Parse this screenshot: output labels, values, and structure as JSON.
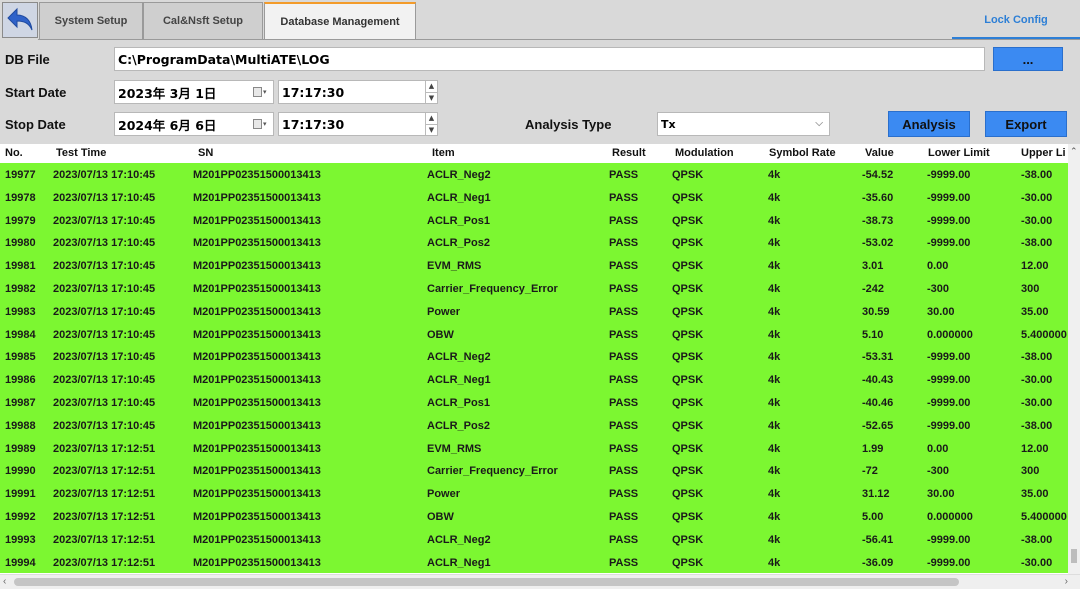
{
  "tabs": [
    {
      "label": "System Setup"
    },
    {
      "label": "Cal&Nsft Setup"
    },
    {
      "label": "Database Management"
    }
  ],
  "lock_config": "Lock Config",
  "form": {
    "db_file_label": "DB File",
    "db_file_value": "C:\\ProgramData\\MultiATE\\LOG",
    "browse_label": "...",
    "start_date_label": "Start Date",
    "start_date_value": "2023年  3月  1日",
    "start_time_value": "17:17:30",
    "stop_date_label": "Stop Date",
    "stop_date_value": "2024年  6月  6日",
    "stop_time_value": "17:17:30",
    "analysis_type_label": "Analysis Type",
    "analysis_type_value": "Tx",
    "analysis_button": "Analysis",
    "export_button": "Export"
  },
  "table": {
    "headers": [
      "No.",
      "Test Time",
      "SN",
      "Item",
      "Result",
      "Modulation",
      "Symbol Rate",
      "Value",
      "Lower Limit",
      "Upper Li"
    ],
    "rows": [
      [
        "19977",
        "2023/07/13 17:10:45",
        "M201PP02351500013413",
        "ACLR_Neg2",
        "PASS",
        "QPSK",
        "4k",
        "-54.52",
        "-9999.00",
        "-38.00"
      ],
      [
        "19978",
        "2023/07/13 17:10:45",
        "M201PP02351500013413",
        "ACLR_Neg1",
        "PASS",
        "QPSK",
        "4k",
        "-35.60",
        "-9999.00",
        "-30.00"
      ],
      [
        "19979",
        "2023/07/13 17:10:45",
        "M201PP02351500013413",
        "ACLR_Pos1",
        "PASS",
        "QPSK",
        "4k",
        "-38.73",
        "-9999.00",
        "-30.00"
      ],
      [
        "19980",
        "2023/07/13 17:10:45",
        "M201PP02351500013413",
        "ACLR_Pos2",
        "PASS",
        "QPSK",
        "4k",
        "-53.02",
        "-9999.00",
        "-38.00"
      ],
      [
        "19981",
        "2023/07/13 17:10:45",
        "M201PP02351500013413",
        "EVM_RMS",
        "PASS",
        "QPSK",
        "4k",
        "3.01",
        "0.00",
        "12.00"
      ],
      [
        "19982",
        "2023/07/13 17:10:45",
        "M201PP02351500013413",
        "Carrier_Frequency_Error",
        "PASS",
        "QPSK",
        "4k",
        "-242",
        "-300",
        "300"
      ],
      [
        "19983",
        "2023/07/13 17:10:45",
        "M201PP02351500013413",
        "Power",
        "PASS",
        "QPSK",
        "4k",
        "30.59",
        "30.00",
        "35.00"
      ],
      [
        "19984",
        "2023/07/13 17:10:45",
        "M201PP02351500013413",
        "OBW",
        "PASS",
        "QPSK",
        "4k",
        "5.10",
        "0.000000",
        "5.400000"
      ],
      [
        "19985",
        "2023/07/13 17:10:45",
        "M201PP02351500013413",
        "ACLR_Neg2",
        "PASS",
        "QPSK",
        "4k",
        "-53.31",
        "-9999.00",
        "-38.00"
      ],
      [
        "19986",
        "2023/07/13 17:10:45",
        "M201PP02351500013413",
        "ACLR_Neg1",
        "PASS",
        "QPSK",
        "4k",
        "-40.43",
        "-9999.00",
        "-30.00"
      ],
      [
        "19987",
        "2023/07/13 17:10:45",
        "M201PP02351500013413",
        "ACLR_Pos1",
        "PASS",
        "QPSK",
        "4k",
        "-40.46",
        "-9999.00",
        "-30.00"
      ],
      [
        "19988",
        "2023/07/13 17:10:45",
        "M201PP02351500013413",
        "ACLR_Pos2",
        "PASS",
        "QPSK",
        "4k",
        "-52.65",
        "-9999.00",
        "-38.00"
      ],
      [
        "19989",
        "2023/07/13 17:12:51",
        "M201PP02351500013413",
        "EVM_RMS",
        "PASS",
        "QPSK",
        "4k",
        "1.99",
        "0.00",
        "12.00"
      ],
      [
        "19990",
        "2023/07/13 17:12:51",
        "M201PP02351500013413",
        "Carrier_Frequency_Error",
        "PASS",
        "QPSK",
        "4k",
        "-72",
        "-300",
        "300"
      ],
      [
        "19991",
        "2023/07/13 17:12:51",
        "M201PP02351500013413",
        "Power",
        "PASS",
        "QPSK",
        "4k",
        "31.12",
        "30.00",
        "35.00"
      ],
      [
        "19992",
        "2023/07/13 17:12:51",
        "M201PP02351500013413",
        "OBW",
        "PASS",
        "QPSK",
        "4k",
        "5.00",
        "0.000000",
        "5.400000"
      ],
      [
        "19993",
        "2023/07/13 17:12:51",
        "M201PP02351500013413",
        "ACLR_Neg2",
        "PASS",
        "QPSK",
        "4k",
        "-56.41",
        "-9999.00",
        "-38.00"
      ],
      [
        "19994",
        "2023/07/13 17:12:51",
        "M201PP02351500013413",
        "ACLR_Neg1",
        "PASS",
        "QPSK",
        "4k",
        "-36.09",
        "-9999.00",
        "-30.00"
      ]
    ]
  },
  "colors": {
    "row_pass_bg": "#7cf731",
    "button_blue": "#3b8af2",
    "active_tab_accent": "#f39b2a",
    "lock_config_blue": "#2d7fd6"
  },
  "icons": {
    "back": "back-arrow-icon",
    "calendar": "calendar-icon",
    "spin": "spinner-icon"
  }
}
